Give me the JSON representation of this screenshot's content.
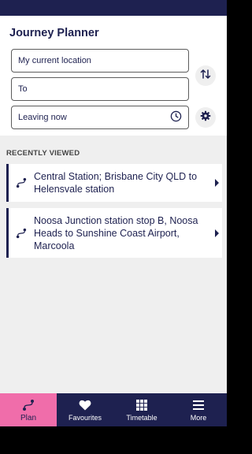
{
  "planner": {
    "title": "Journey Planner",
    "origin_value": "My current location",
    "destination_placeholder": "To",
    "time_value": "Leaving now",
    "icons": {
      "swap": "swap-vertical-icon",
      "clock": "clock-icon",
      "settings": "gear-icon"
    }
  },
  "recent": {
    "section_title": "RECENTLY VIEWED",
    "items": [
      {
        "label": "Central Station; Brisbane City QLD to Helensvale station",
        "icon": "route-icon"
      },
      {
        "label": "Noosa Junction station stop B, Noosa Heads to Sunshine Coast Airport, Marcoola",
        "icon": "route-icon"
      }
    ]
  },
  "tabs": [
    {
      "label": "Plan",
      "icon": "route-icon",
      "active": true
    },
    {
      "label": "Favourites",
      "icon": "heart-icon",
      "active": false
    },
    {
      "label": "Timetable",
      "icon": "grid-icon",
      "active": false
    },
    {
      "label": "More",
      "icon": "menu-icon",
      "active": false
    }
  ],
  "colors": {
    "primary": "#1e2150",
    "accent": "#f06daa",
    "background": "#efefef"
  }
}
